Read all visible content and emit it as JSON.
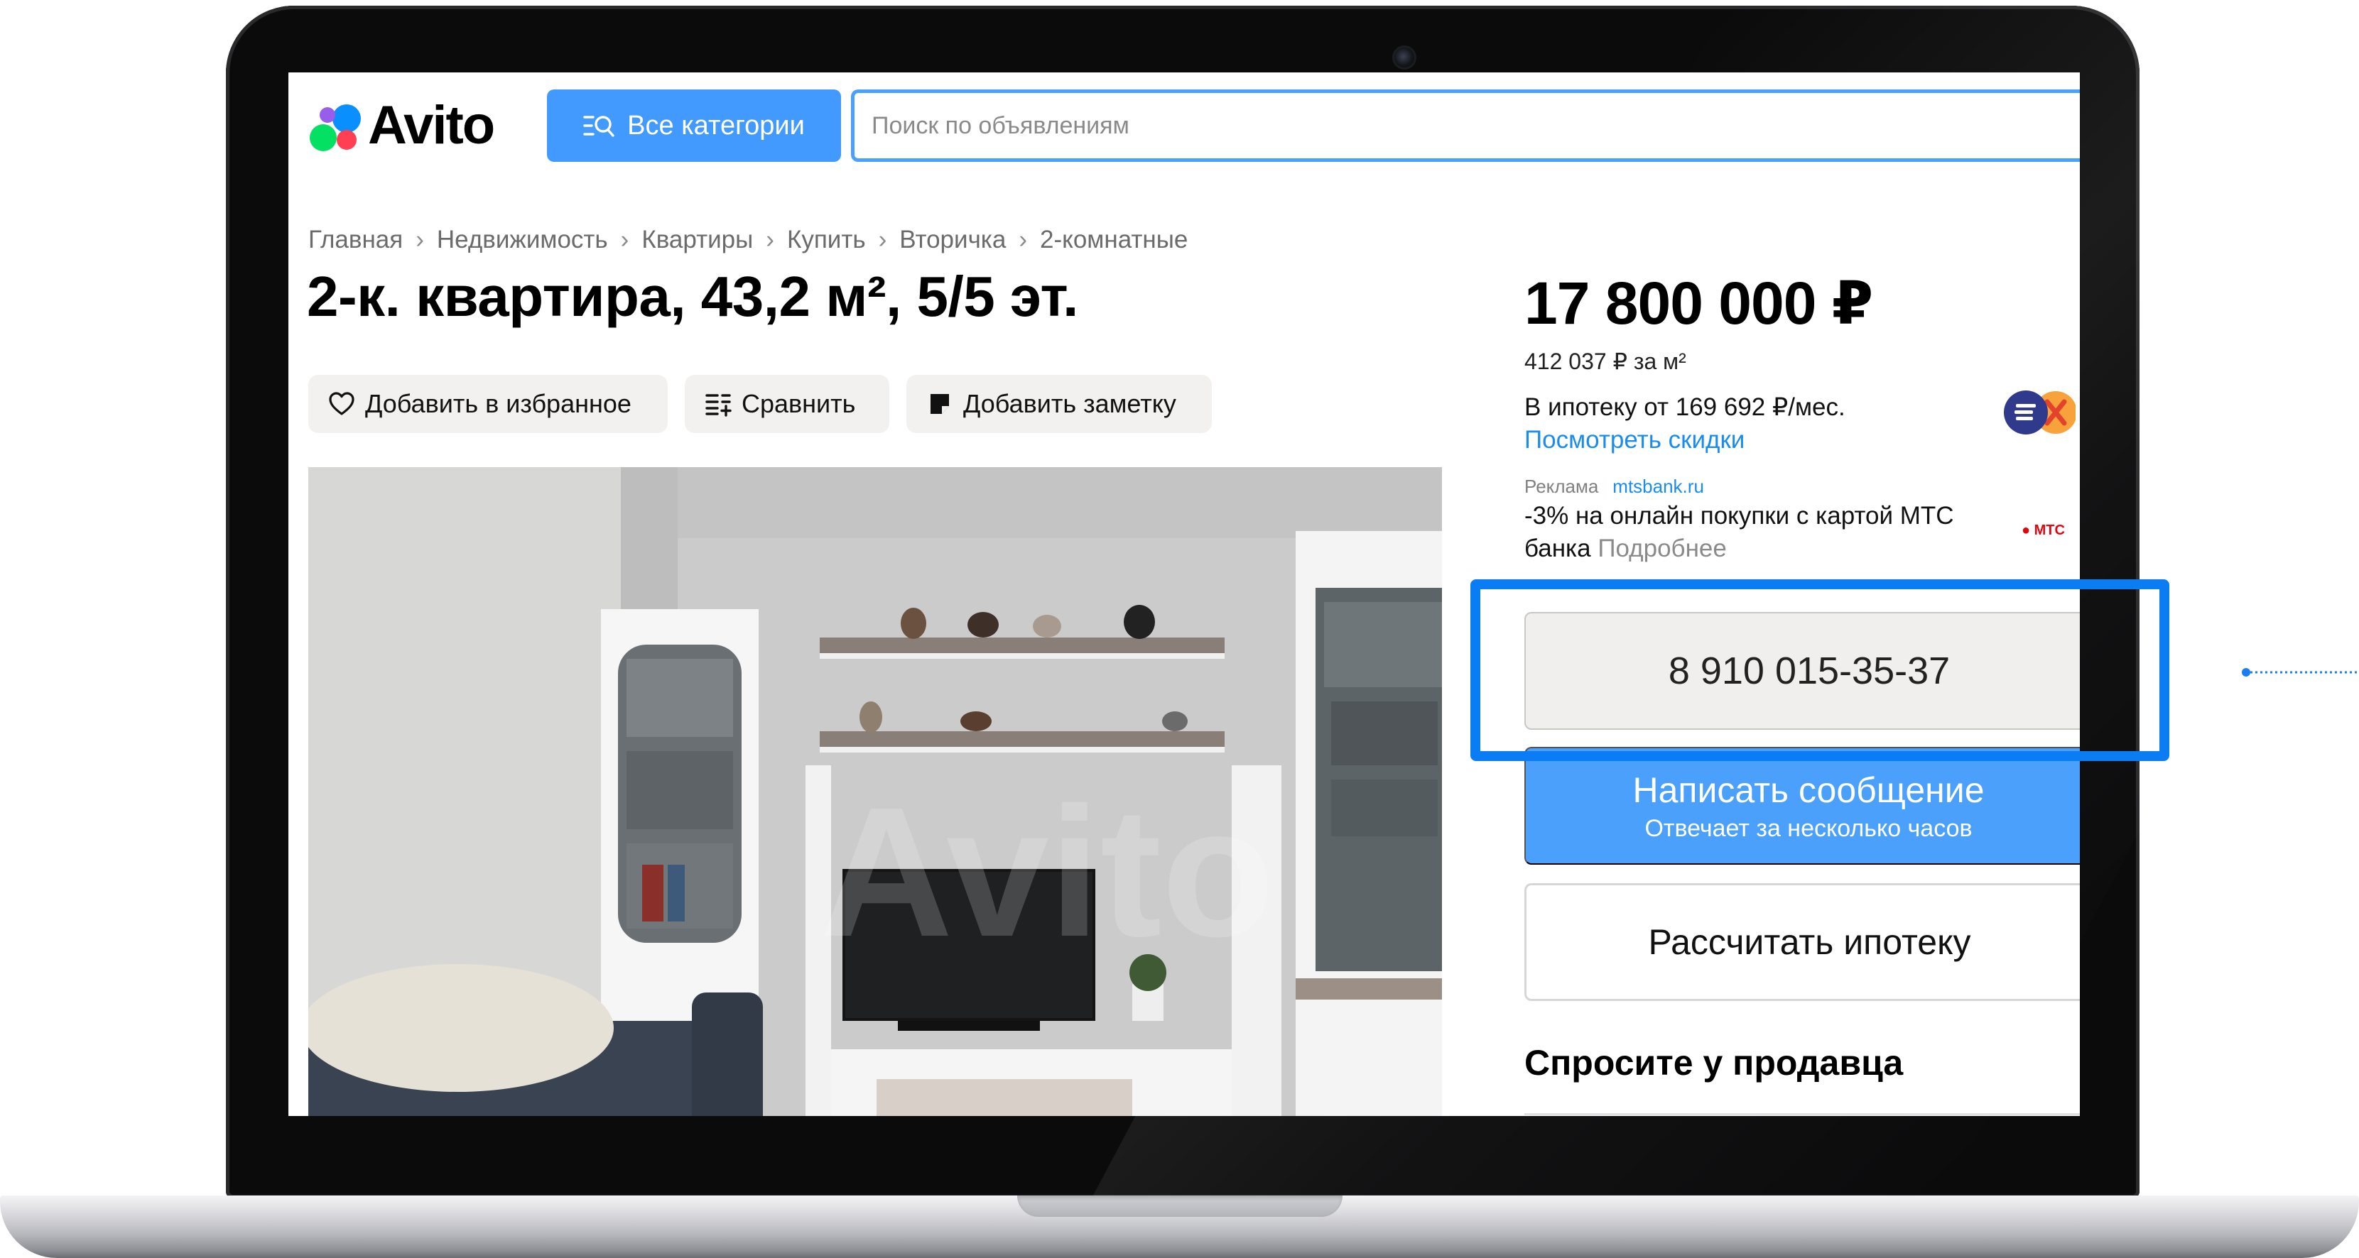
{
  "header": {
    "logo_text": "Avito",
    "categories_button": "Все категории",
    "search_placeholder": "Поиск по объявлениям"
  },
  "breadcrumb": [
    "Главная",
    "Недвижимость",
    "Квартиры",
    "Купить",
    "Вторичка",
    "2-комнатные"
  ],
  "breadcrumb_separator": "›",
  "listing": {
    "title": "2-к. квартира, 43,2 м², 5/5 эт.",
    "actions": {
      "favorite": "Добавить в избранное",
      "compare": "Сравнить",
      "note": "Добавить заметку"
    },
    "photo_watermark": "Avito"
  },
  "sidebar": {
    "price": "17 800 000 ₽",
    "price_per_m2": "412 037 ₽ за м²",
    "mortgage_from": "В ипотеку от 169 692 ₽/мес.",
    "discount_link": "Посмотреть скидки",
    "ad": {
      "label": "Реклама",
      "domain": "mtsbank.ru",
      "text": "-3% на онлайн покупки с картой МТС банка",
      "more": "Подробнее",
      "logo_text": "МТС"
    },
    "phone_button": "8 910 015-35-37",
    "message_button": "Написать сообщение",
    "message_subtext": "Отвечает за несколько часов",
    "mortgage_button": "Рассчитать ипотеку",
    "ask_seller_heading": "Спросите у продавца"
  },
  "colors": {
    "accent_blue": "#439afe",
    "link_blue": "#1a8cf0",
    "highlight_blue": "#0a7df5",
    "button_gray": "#f0efed",
    "mts_red": "#e30611"
  }
}
